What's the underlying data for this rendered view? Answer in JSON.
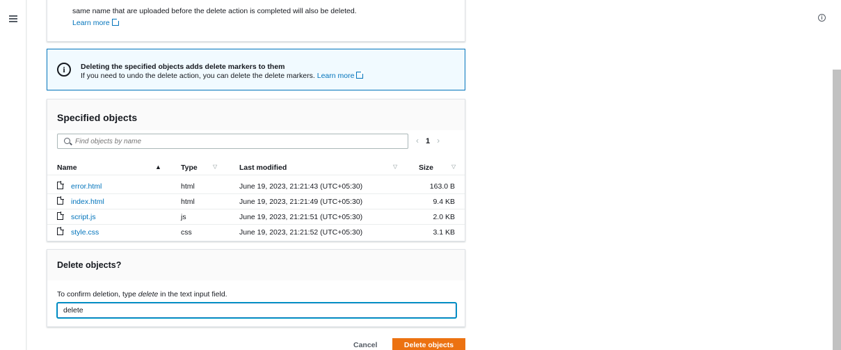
{
  "top_panel": {
    "text": "same name that are uploaded before the delete action is completed will also be deleted.",
    "learn_more": "Learn more"
  },
  "alert": {
    "icon": "info-icon",
    "title": "Deleting the specified objects adds delete markers to them",
    "text": "If you need to undo the delete action, you can delete the delete markers.",
    "learn_more": "Learn more"
  },
  "objects": {
    "title": "Specified objects",
    "search_placeholder": "Find objects by name",
    "page": "1",
    "columns": [
      "Name",
      "Type",
      "Last modified",
      "Size"
    ],
    "rows": [
      {
        "name": "error.html",
        "type": "html",
        "modified": "June 19, 2023, 21:21:43 (UTC+05:30)",
        "size": "163.0 B"
      },
      {
        "name": "index.html",
        "type": "html",
        "modified": "June 19, 2023, 21:21:49 (UTC+05:30)",
        "size": "9.4 KB"
      },
      {
        "name": "script.js",
        "type": "js",
        "modified": "June 19, 2023, 21:21:51 (UTC+05:30)",
        "size": "2.0 KB"
      },
      {
        "name": "style.css",
        "type": "css",
        "modified": "June 19, 2023, 21:21:52 (UTC+05:30)",
        "size": "3.1 KB"
      }
    ]
  },
  "confirm": {
    "title": "Delete objects?",
    "label_prefix": "To confirm deletion, type ",
    "label_keyword": "delete",
    "label_suffix": " in the text input field.",
    "value": "delete"
  },
  "actions": {
    "cancel": "Cancel",
    "delete": "Delete objects"
  },
  "colors": {
    "link": "#0073bb",
    "primary_button": "#ec7211",
    "alert_bg": "#f1faff"
  }
}
